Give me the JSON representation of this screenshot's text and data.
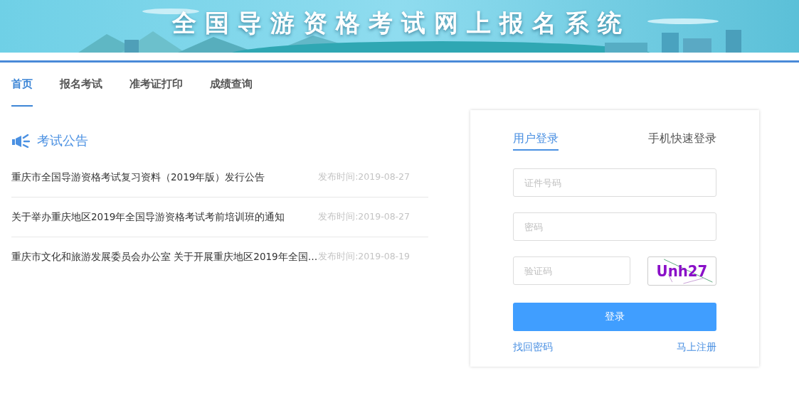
{
  "banner": {
    "title": "全国导游资格考试网上报名系统"
  },
  "nav": [
    {
      "label": "首页",
      "selected": true
    },
    {
      "label": "报名考试",
      "selected": false
    },
    {
      "label": "准考证打印",
      "selected": false
    },
    {
      "label": "成绩查询",
      "selected": false
    }
  ],
  "notices": {
    "title": "考试公告",
    "items": [
      {
        "title": "重庆市全国导游资格考试复习资料（2019年版）发行公告",
        "date": "发布时间:2019-08-27"
      },
      {
        "title": "关于举办重庆地区2019年全国导游资格考试考前培训班的通知",
        "date": "发布时间:2019-08-27"
      },
      {
        "title": "重庆市文化和旅游发展委员会办公室 关于开展重庆地区2019年全国…",
        "date": "发布时间:2019-08-19"
      }
    ]
  },
  "login": {
    "tabs": [
      {
        "label": "用户登录",
        "selected": true
      },
      {
        "label": "手机快速登录",
        "selected": false
      }
    ],
    "id_field": {
      "placeholder": "证件号码"
    },
    "password_field": {
      "placeholder": "密码"
    },
    "captcha_field": {
      "placeholder": "验证码"
    },
    "captcha": "Unh27",
    "submit": "登录",
    "links": [
      "找回密码",
      "马上注册"
    ]
  }
}
